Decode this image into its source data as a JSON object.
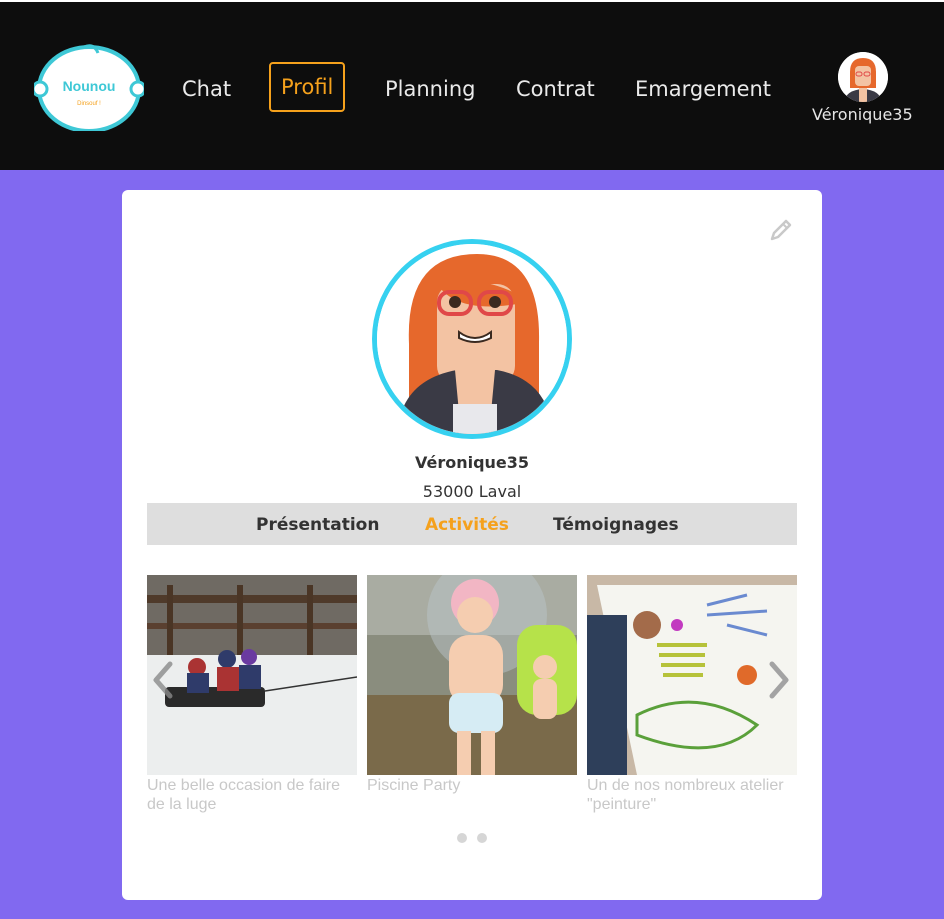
{
  "header": {
    "logo": {
      "brand": "Nounou",
      "tagline": "Dinsouf !"
    },
    "nav": [
      {
        "label": "Chat"
      },
      {
        "label": "Profil"
      },
      {
        "label": "Planning"
      },
      {
        "label": "Contrat"
      },
      {
        "label": "Emargement"
      }
    ],
    "user": {
      "name": "Véronique35"
    }
  },
  "profile": {
    "name": "Véronique35",
    "location": "53000 Laval"
  },
  "tabs": [
    {
      "label": "Présentation"
    },
    {
      "label": "Activités"
    },
    {
      "label": "Témoignages"
    }
  ],
  "carousel": {
    "slides": [
      {
        "caption": "Une belle occasion de faire de la luge"
      },
      {
        "caption": "Piscine Party"
      },
      {
        "caption": "Un de nos nombreux atelier \"peinture\""
      }
    ]
  },
  "colors": {
    "accent": "#f5a11c",
    "background": "#8169f0",
    "ring": "#36d1f0"
  }
}
